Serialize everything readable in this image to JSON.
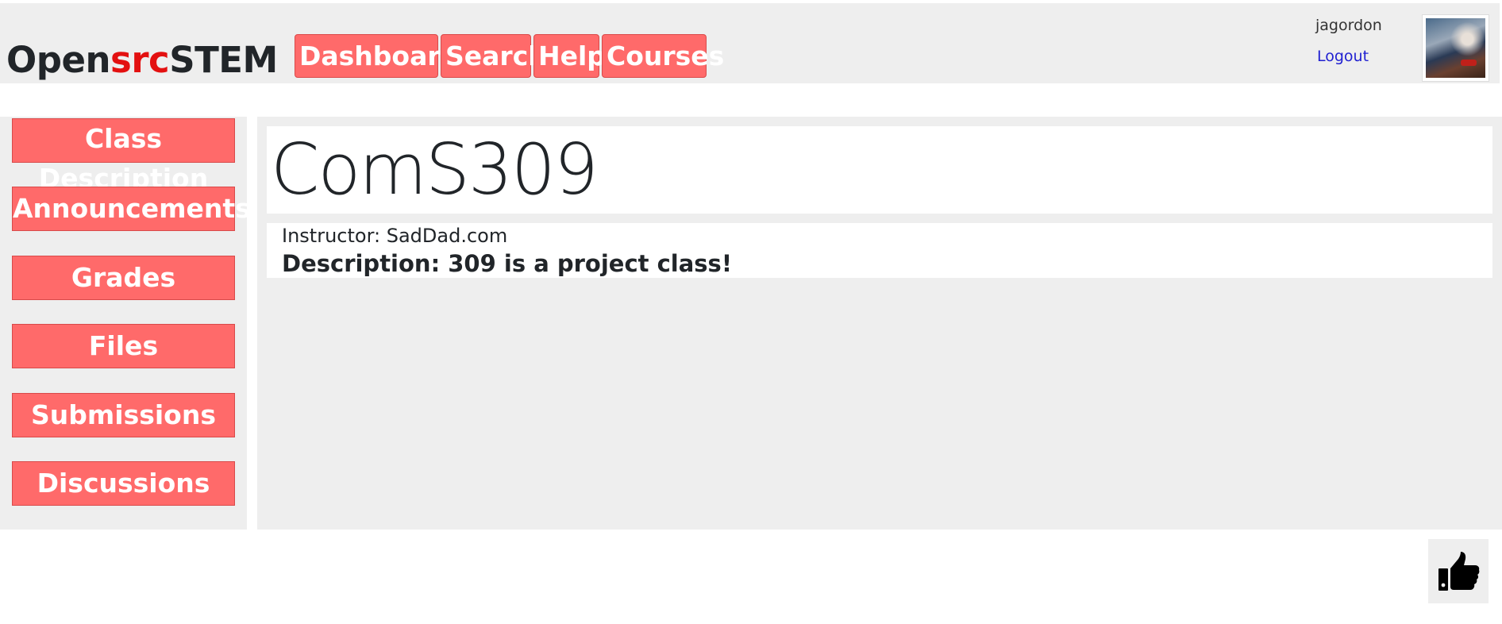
{
  "header": {
    "logo_part1": "Open",
    "logo_part2": "src",
    "logo_part3": "STEM",
    "nav": [
      "Dashboard",
      "Search",
      "Help",
      "Courses"
    ],
    "username": "jagordon",
    "logout_label": "Logout"
  },
  "sidebar": {
    "items": [
      "Class Description",
      "Announcements",
      "Grades",
      "Files",
      "Submissions",
      "Discussions"
    ]
  },
  "course": {
    "title": "ComS309",
    "instructor": "Instructor: SadDad.com",
    "description": "Description: 309 is a project class!"
  },
  "icons": {
    "like": "thumbs-up-icon"
  },
  "colors": {
    "accent_button": "#ff6a6a",
    "logo_accent": "#e31010",
    "panel_bg": "#eeeeee",
    "link": "#1f1fd1"
  }
}
